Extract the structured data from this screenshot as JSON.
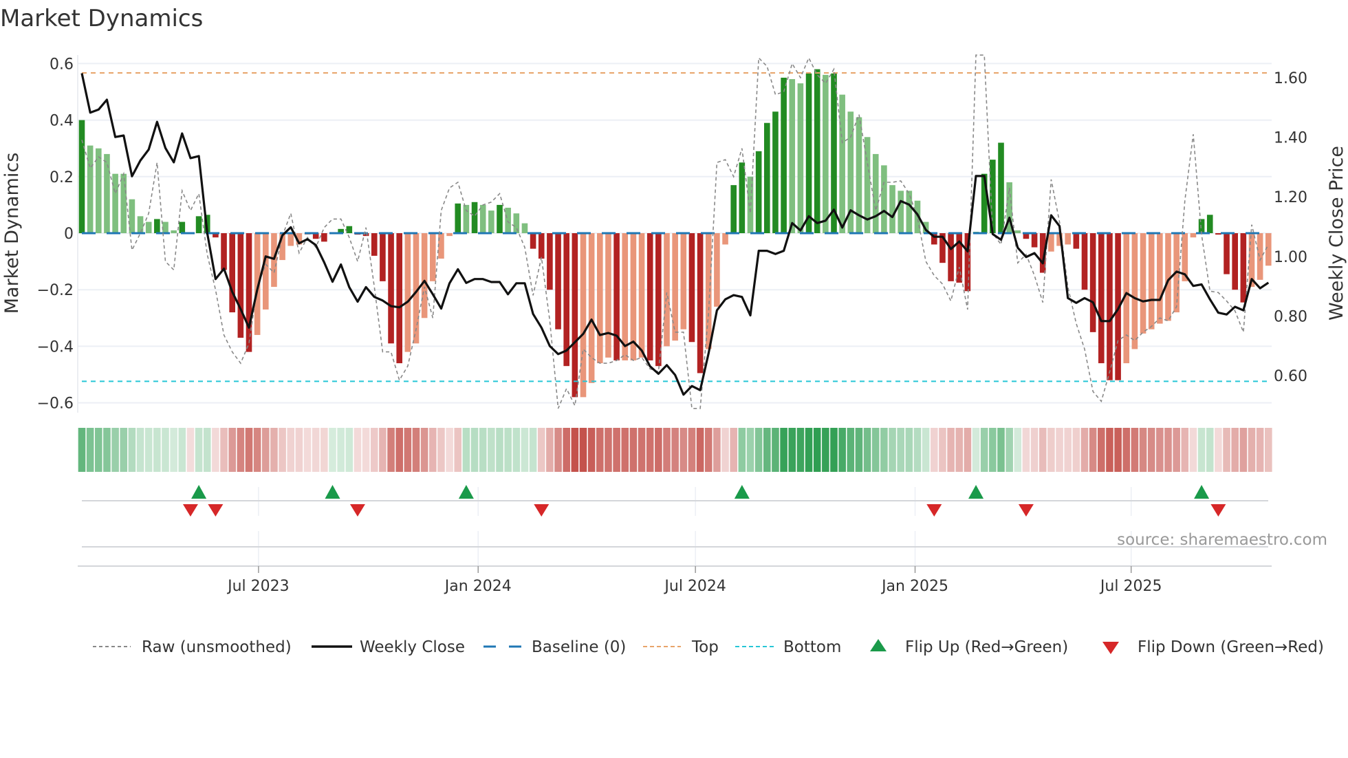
{
  "chart_data": {
    "type": "bar",
    "title": "Market Dynamics",
    "ylabel": "Market Dynamics",
    "ylabel_right": "Weekly Close Price",
    "source": "source: sharemaestro.com",
    "x_start": "2023-02-03",
    "x_step_days": 7,
    "ylim": [
      -0.63,
      0.63
    ],
    "ylim_right": [
      0.49,
      1.66
    ],
    "y_ticks": [
      0.6,
      0.4,
      0.2,
      0,
      -0.2,
      -0.4,
      -0.6
    ],
    "y_tick_labels": [
      "0.6",
      "0.4",
      "0.2",
      "0",
      "−0.2",
      "−0.4",
      "−0.6"
    ],
    "y_right_ticks": [
      1.6,
      1.4,
      1.2,
      1.0,
      0.8,
      0.6
    ],
    "y_right_tick_labels": [
      "1.60",
      "1.40",
      "1.20",
      "1.00",
      "0.80",
      "0.60"
    ],
    "x_ticks": [
      {
        "date": "2023-07-01",
        "label": "Jul 2023"
      },
      {
        "date": "2024-01-01",
        "label": "Jan 2024"
      },
      {
        "date": "2024-07-01",
        "label": "Jul 2024"
      },
      {
        "date": "2025-01-01",
        "label": "Jan 2025"
      },
      {
        "date": "2025-07-01",
        "label": "Jul 2025"
      }
    ],
    "grid": true,
    "top_threshold": 0.567,
    "bottom_threshold": -0.524,
    "baseline": 0,
    "colors": {
      "strong_up": "#228b22",
      "weak_up": "#7fbf7f",
      "strong_down": "#b22222",
      "weak_down": "#e9967a",
      "close": "#111111",
      "raw": "#888888",
      "baseline": "#1f77b4",
      "top": "#e8a46a",
      "bottom": "#26c6d6",
      "flip_up": "#1a9a4a",
      "flip_down": "#d62728",
      "strip_green": "#2f9e52",
      "strip_red": "#c4524c"
    },
    "momentum": [
      0.4,
      0.31,
      0.3,
      0.28,
      0.21,
      0.21,
      0.12,
      0.06,
      0.04,
      0.05,
      0.04,
      0.01,
      0.04,
      0.0,
      0.06,
      0.065,
      -0.015,
      -0.13,
      -0.28,
      -0.37,
      -0.42,
      -0.36,
      -0.27,
      -0.19,
      -0.095,
      -0.045,
      -0.04,
      -0.005,
      -0.02,
      -0.03,
      0.0,
      0.015,
      0.025,
      -0.005,
      -0.01,
      -0.08,
      -0.17,
      -0.39,
      -0.46,
      -0.42,
      -0.39,
      -0.3,
      -0.17,
      -0.09,
      -0.01,
      0.105,
      0.1,
      0.11,
      0.1,
      0.08,
      0.1,
      0.09,
      0.07,
      0.035,
      -0.055,
      -0.09,
      -0.2,
      -0.34,
      -0.47,
      -0.58,
      -0.58,
      -0.53,
      -0.46,
      -0.44,
      -0.45,
      -0.45,
      -0.45,
      -0.44,
      -0.45,
      -0.47,
      -0.4,
      -0.38,
      -0.34,
      -0.385,
      -0.495,
      -0.41,
      -0.26,
      -0.04,
      0.17,
      0.25,
      0.2,
      0.29,
      0.39,
      0.43,
      0.55,
      0.545,
      0.53,
      0.565,
      0.58,
      0.56,
      0.565,
      0.49,
      0.43,
      0.41,
      0.34,
      0.28,
      0.24,
      0.17,
      0.15,
      0.15,
      0.115,
      0.04,
      -0.04,
      -0.105,
      -0.17,
      -0.175,
      -0.205,
      0.005,
      0.21,
      0.26,
      0.32,
      0.18,
      0.01,
      -0.02,
      -0.05,
      -0.14,
      -0.065,
      -0.045,
      -0.04,
      -0.055,
      -0.2,
      -0.35,
      -0.46,
      -0.52,
      -0.52,
      -0.46,
      -0.41,
      -0.355,
      -0.34,
      -0.32,
      -0.31,
      -0.28,
      -0.17,
      -0.015,
      0.05,
      0.065,
      -0.005,
      -0.145,
      -0.2,
      -0.245,
      -0.19,
      -0.165,
      -0.115
    ],
    "strong_flags": "10000000010010111111100000001101111111100000010100100011111100001000110001100011011110011010000000000011111011100111000111111000000000111111000",
    "raw": [
      0.33,
      0.23,
      0.27,
      0.25,
      0.14,
      0.21,
      -0.06,
      0.0,
      0.07,
      0.25,
      -0.1,
      -0.13,
      0.15,
      0.08,
      0.14,
      -0.075,
      -0.2,
      -0.36,
      -0.42,
      -0.46,
      -0.39,
      -0.19,
      -0.11,
      -0.14,
      -0.01,
      0.07,
      -0.07,
      -0.015,
      -0.05,
      0.02,
      0.05,
      0.05,
      -0.015,
      -0.1,
      0.02,
      -0.19,
      -0.42,
      -0.42,
      -0.52,
      -0.47,
      -0.34,
      -0.19,
      -0.3,
      0.08,
      0.16,
      0.18,
      0.08,
      0.06,
      0.1,
      0.11,
      0.14,
      0.04,
      0.02,
      -0.05,
      -0.22,
      -0.085,
      -0.31,
      -0.62,
      -0.55,
      -0.61,
      -0.41,
      -0.44,
      -0.46,
      -0.46,
      -0.45,
      -0.43,
      -0.45,
      -0.44,
      -0.48,
      -0.49,
      -0.21,
      -0.35,
      -0.35,
      -0.62,
      -0.62,
      -0.28,
      0.25,
      0.26,
      0.2,
      0.3,
      0.07,
      0.62,
      0.59,
      0.49,
      0.5,
      0.6,
      0.55,
      0.62,
      0.56,
      0.53,
      0.58,
      0.32,
      0.34,
      0.42,
      0.25,
      0.08,
      0.18,
      0.18,
      0.185,
      0.14,
      0.055,
      -0.1,
      -0.15,
      -0.18,
      -0.24,
      -0.12,
      -0.27,
      0.63,
      0.63,
      0.0,
      -0.04,
      0.16,
      -0.105,
      -0.075,
      -0.15,
      -0.245,
      0.19,
      0.04,
      -0.19,
      -0.32,
      -0.41,
      -0.56,
      -0.595,
      -0.49,
      -0.38,
      -0.36,
      -0.38,
      -0.35,
      -0.33,
      -0.3,
      -0.31,
      -0.26,
      0.115,
      0.35,
      -0.005,
      -0.205,
      -0.21,
      -0.24,
      -0.275,
      -0.35,
      0.03,
      -0.095,
      -0.04
    ],
    "close": [
      1.615,
      1.483,
      1.493,
      1.526,
      1.401,
      1.406,
      1.269,
      1.322,
      1.359,
      1.452,
      1.364,
      1.316,
      1.413,
      1.33,
      1.337,
      1.079,
      0.924,
      0.959,
      0.881,
      0.823,
      0.761,
      0.889,
      1.0,
      0.992,
      1.071,
      1.098,
      1.044,
      1.058,
      1.038,
      0.98,
      0.915,
      0.973,
      0.897,
      0.848,
      0.897,
      0.864,
      0.852,
      0.833,
      0.829,
      0.848,
      0.881,
      0.918,
      0.873,
      0.825,
      0.91,
      0.957,
      0.911,
      0.924,
      0.924,
      0.914,
      0.914,
      0.873,
      0.91,
      0.91,
      0.807,
      0.761,
      0.699,
      0.672,
      0.684,
      0.712,
      0.74,
      0.788,
      0.736,
      0.743,
      0.734,
      0.699,
      0.714,
      0.684,
      0.631,
      0.606,
      0.635,
      0.602,
      0.536,
      0.565,
      0.551,
      0.675,
      0.819,
      0.856,
      0.87,
      0.864,
      0.802,
      1.019,
      1.019,
      1.008,
      1.019,
      1.112,
      1.087,
      1.135,
      1.112,
      1.12,
      1.157,
      1.097,
      1.155,
      1.138,
      1.124,
      1.135,
      1.153,
      1.132,
      1.186,
      1.174,
      1.141,
      1.089,
      1.066,
      1.066,
      1.025,
      1.05,
      1.017,
      1.27,
      1.27,
      1.075,
      1.056,
      1.13,
      1.029,
      0.998,
      1.011,
      0.977,
      1.138,
      1.102,
      0.86,
      0.844,
      0.86,
      0.846,
      0.783,
      0.783,
      0.823,
      0.877,
      0.86,
      0.849,
      0.854,
      0.854,
      0.92,
      0.949,
      0.94,
      0.901,
      0.906,
      0.856,
      0.811,
      0.805,
      0.831,
      0.819,
      0.924,
      0.893,
      0.912
    ],
    "flip_up_index": [
      14,
      30,
      46,
      79,
      107,
      134
    ],
    "flip_down_index": [
      13,
      16,
      33,
      55,
      102,
      113,
      136
    ],
    "legend": {
      "placement": "bottom",
      "raw": "Raw (unsmoothed)",
      "close": "Weekly Close",
      "baseline": "Baseline (0)",
      "top": "Top",
      "bottom": "Bottom",
      "flip_up": "Flip Up (Red→Green)",
      "flip_down": "Flip Down (Green→Red)"
    }
  }
}
